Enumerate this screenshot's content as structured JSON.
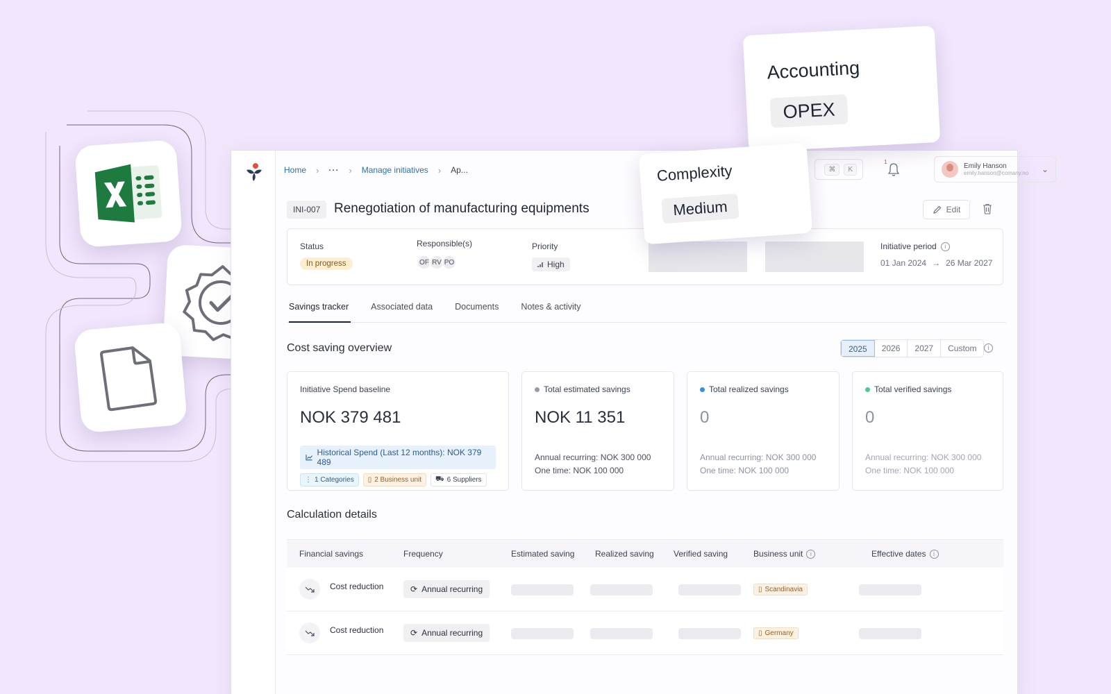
{
  "breadcrumb": {
    "home": "Home",
    "ellipsis": "···",
    "manage": "Manage initiatives",
    "current": "Ap..."
  },
  "search_shortcut": {
    "k1": "⌘",
    "k2": "K"
  },
  "notifications": {
    "count": "1"
  },
  "user": {
    "name": "Emily Hanson",
    "email": "emily.hanson@comany.no"
  },
  "initiative": {
    "id": "INI-007",
    "title": "Renegotiation of manufacturing equipments",
    "edit_label": "Edit"
  },
  "meta": {
    "status_label": "Status",
    "status_value": "In progress",
    "responsible_label": "Responsible(s)",
    "responsibles": [
      "OF",
      "RV",
      "PO"
    ],
    "priority_label": "Priority",
    "priority_value": "High",
    "period_label": "Initiative period",
    "period_start": "01 Jan 2024",
    "period_end": "26 Mar 2027"
  },
  "tabs": [
    "Savings tracker",
    "Associated data",
    "Documents",
    "Notes & activity"
  ],
  "overview": {
    "title": "Cost saving overview",
    "years": [
      "2025",
      "2026",
      "2027",
      "Custom"
    ],
    "selected_year": "2025"
  },
  "cards": {
    "baseline": {
      "label": "Initiative Spend baseline",
      "value": "NOK 379 481",
      "historical": "Historical Spend (Last 12 months): NOK 379 489",
      "chip_categories": "1 Categories",
      "chip_business": "2 Business unit",
      "chip_suppliers": "6 Suppliers"
    },
    "estimated": {
      "label": "Total estimated savings",
      "value": "NOK 11 351",
      "annual": "Annual recurring: NOK 300 000",
      "onetime": "One time: NOK 100 000",
      "dot_color": "#9a9ca5"
    },
    "realized": {
      "label": "Total realized savings",
      "value": "0",
      "annual": "Annual recurring: NOK 300 000",
      "onetime": "One time: NOK 100 000",
      "dot_color": "#3b8fd8"
    },
    "verified": {
      "label": "Total verified savings",
      "value": "0",
      "annual": "Annual recurring: NOK 300 000",
      "onetime": "One time: NOK 100 000",
      "dot_color": "#4fc59a"
    }
  },
  "calc": {
    "title": "Calculation details",
    "headers": {
      "financial": "Financial savings",
      "frequency": "Frequency",
      "estimated": "Estimated saving",
      "realized": "Realized saving",
      "verified": "Verified saving",
      "business": "Business unit",
      "dates": "Effective dates"
    },
    "rows": [
      {
        "type": "Cost reduction",
        "frequency": "Annual recurring",
        "business_unit": "Scandinavia"
      },
      {
        "type": "Cost reduction",
        "frequency": "Annual recurring",
        "business_unit": "Germany"
      }
    ]
  },
  "floating": {
    "accounting_title": "Accounting",
    "accounting_value": "OPEX",
    "complexity_title": "Complexity",
    "complexity_value": "Medium"
  },
  "icons": [
    "excel-icon",
    "verified-badge-icon",
    "document-icon",
    "bell-icon",
    "trash-icon",
    "edit-icon",
    "info-icon",
    "trend-down-icon",
    "refresh-icon"
  ],
  "colors": {
    "accent": "#2f6fa8",
    "background": "#f1e6fc",
    "excel_green": "#1f7a3f"
  }
}
